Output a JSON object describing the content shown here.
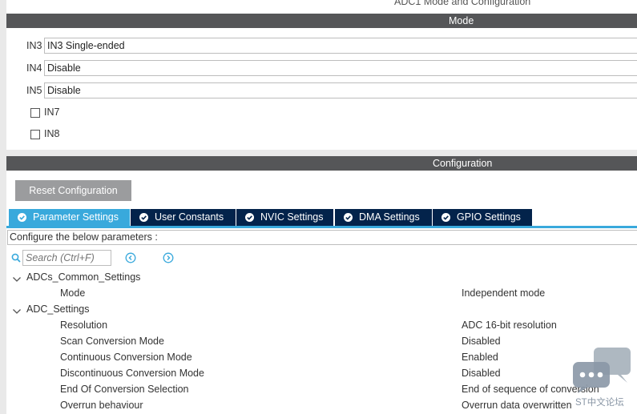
{
  "window": {
    "title": "ADC1 Mode and Configuration"
  },
  "mode": {
    "header": "Mode",
    "rows": [
      {
        "label": "IN3",
        "value": "IN3 Single-ended"
      },
      {
        "label": "IN4",
        "value": "Disable"
      },
      {
        "label": "IN5",
        "value": "Disable"
      }
    ],
    "checkboxes": [
      {
        "label": "IN7",
        "checked": false
      },
      {
        "label": "IN8",
        "checked": false
      }
    ]
  },
  "configuration": {
    "header": "Configuration",
    "reset_label": "Reset Configuration",
    "tabs": [
      {
        "label": "Parameter Settings",
        "active": true
      },
      {
        "label": "User Constants",
        "active": false
      },
      {
        "label": "NVIC Settings",
        "active": false
      },
      {
        "label": "DMA Settings",
        "active": false
      },
      {
        "label": "GPIO Settings",
        "active": false
      }
    ],
    "param_header": "Configure the below parameters :",
    "search_placeholder": "Search (Ctrl+F)",
    "tree": {
      "common": {
        "label": "ADCs_Common_Settings",
        "items": [
          {
            "name": "Mode",
            "value": "Independent mode"
          }
        ]
      },
      "adc": {
        "label": "ADC_Settings",
        "items": [
          {
            "name": "Resolution",
            "value": "ADC 16-bit resolution"
          },
          {
            "name": "Scan Conversion Mode",
            "value": "Disabled"
          },
          {
            "name": "Continuous Conversion Mode",
            "value": "Enabled"
          },
          {
            "name": "Discontinuous Conversion Mode",
            "value": "Disabled"
          },
          {
            "name": "End Of Conversion Selection",
            "value": "End of sequence of conversion"
          },
          {
            "name": "Overrun behaviour",
            "value": "Overrun data overwritten"
          }
        ]
      }
    }
  },
  "watermark": {
    "text": "ST中文论坛"
  },
  "colors": {
    "tab_active": "#39a9dc",
    "tab_inactive": "#03234b",
    "section_bar": "#555658",
    "button": "#9b9c9e"
  }
}
